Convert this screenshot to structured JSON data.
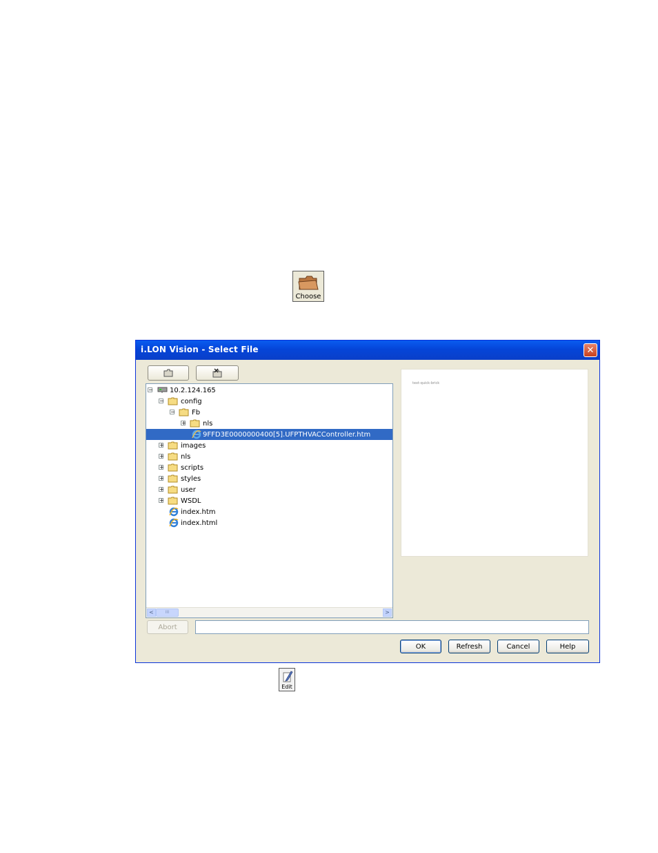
{
  "choose": {
    "label": "Choose",
    "icon": "folder-icon"
  },
  "edit": {
    "label": "Edit",
    "icon": "edit-pencil-icon"
  },
  "dialog": {
    "title": "i.LON Vision - Select File",
    "close_label": "✕",
    "toolbar": [
      {
        "icon": "new-folder-icon"
      },
      {
        "icon": "delete-folder-icon"
      }
    ],
    "tree": [
      {
        "label": "10.2.124.165",
        "icon": "network-drive-icon",
        "expander": "−"
      },
      {
        "label": "config",
        "icon": "folder-icon",
        "expander": "−"
      },
      {
        "label": "Fb",
        "icon": "folder-icon",
        "expander": "−"
      },
      {
        "label": "nls",
        "icon": "folder-icon",
        "expander": "+"
      },
      {
        "label": "9FFD3E0000000400[5].UFPTHVACController.htm",
        "icon": "ie-file-icon",
        "selected": true
      },
      {
        "label": "images",
        "icon": "folder-icon",
        "expander": "+"
      },
      {
        "label": "nls",
        "icon": "folder-icon",
        "expander": "+"
      },
      {
        "label": "scripts",
        "icon": "folder-icon",
        "expander": "+"
      },
      {
        "label": "styles",
        "icon": "folder-icon",
        "expander": "+"
      },
      {
        "label": "user",
        "icon": "folder-icon",
        "expander": "+"
      },
      {
        "label": "WSDL",
        "icon": "folder-icon",
        "expander": "+"
      },
      {
        "label": "index.htm",
        "icon": "ie-file-icon"
      },
      {
        "label": "index.html",
        "icon": "ie-file-icon"
      }
    ],
    "scrollbar": {
      "left": "<",
      "right": ">",
      "grip": "III"
    },
    "preview_text": "text-quick-brick",
    "abort_label": "Abort",
    "path_value": "",
    "buttons": {
      "ok": "OK",
      "refresh": "Refresh",
      "cancel": "Cancel",
      "help": "Help"
    }
  }
}
